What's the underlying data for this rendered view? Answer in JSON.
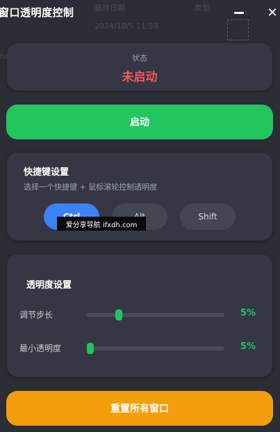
{
  "background": {
    "ghost_text_1": "最终日期",
    "ghost_text_2": "类型",
    "ghost_text_3": "2024/10/5 11:59",
    "ghost_text_4": "ro"
  },
  "window": {
    "title": "窗口透明度控制",
    "minimize_icon": "minus-icon",
    "close_icon": "close-icon",
    "close_glyph": "✕"
  },
  "status": {
    "label": "状态",
    "value": "未启动",
    "value_color": "#f25a5a"
  },
  "start_button": {
    "label": "启动",
    "color": "#22c55e"
  },
  "hotkey": {
    "title": "快捷键设置",
    "description": "选择一个快捷键 + 鼠标滚轮控制透明度",
    "keys": [
      {
        "label": "Ctrl",
        "selected": true
      },
      {
        "label": "Alt",
        "selected": false
      },
      {
        "label": "Shift",
        "selected": false
      }
    ],
    "accent": "#3b82f6"
  },
  "watermark": {
    "text": "爱分享导航 ifxdh.com"
  },
  "opacity": {
    "title": "透明度设置",
    "step": {
      "label": "调节步长",
      "value_text": "5%",
      "level": 0.22
    },
    "min": {
      "label": "最小透明度",
      "value_text": "5%",
      "level": 0.0
    }
  },
  "reset_button": {
    "label": "重置所有窗口",
    "color": "#f59e0b"
  }
}
